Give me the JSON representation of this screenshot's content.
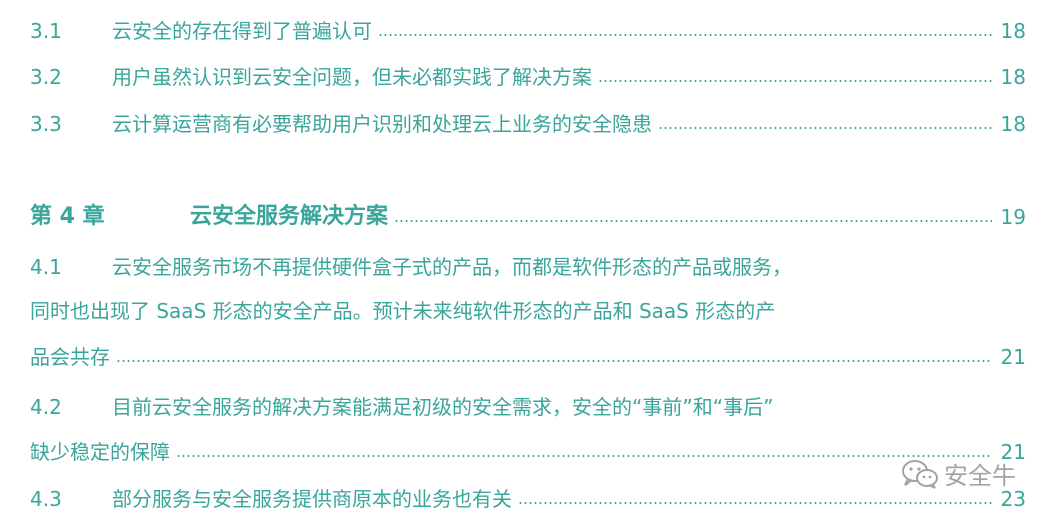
{
  "toc": {
    "s31": {
      "num": "3.1",
      "title": "云安全的存在得到了普遍认可",
      "page": "18"
    },
    "s32": {
      "num": "3.2",
      "title": "用户虽然认识到云安全问题，但未必都实践了解决方案",
      "page": "18"
    },
    "s33": {
      "num": "3.3",
      "title": "云计算运营商有必要帮助用户识别和处理云上业务的安全隐患",
      "page": "18"
    },
    "ch4": {
      "num": "第 4 章",
      "title": "云安全服务解决方案",
      "page": "19"
    },
    "s41": {
      "num": "4.1",
      "line1": "云安全服务市场不再提供硬件盒子式的产品，而都是软件形态的产品或服务，",
      "line2": "同时也出现了 SaaS 形态的安全产品。预计未来纯软件形态的产品和 SaaS 形态的产",
      "line3": "品会共存",
      "page": "21"
    },
    "s42": {
      "num": "4.2",
      "line1": "目前云安全服务的解决方案能满足初级的安全需求，安全的“事前”和“事后”",
      "line2": "缺少稳定的保障",
      "page": "21"
    },
    "s43": {
      "num": "4.3",
      "title": "部分服务与安全服务提供商原本的业务也有关",
      "page": "23"
    }
  },
  "watermark": {
    "text": "安全牛",
    "icon": "wechat-icon"
  }
}
